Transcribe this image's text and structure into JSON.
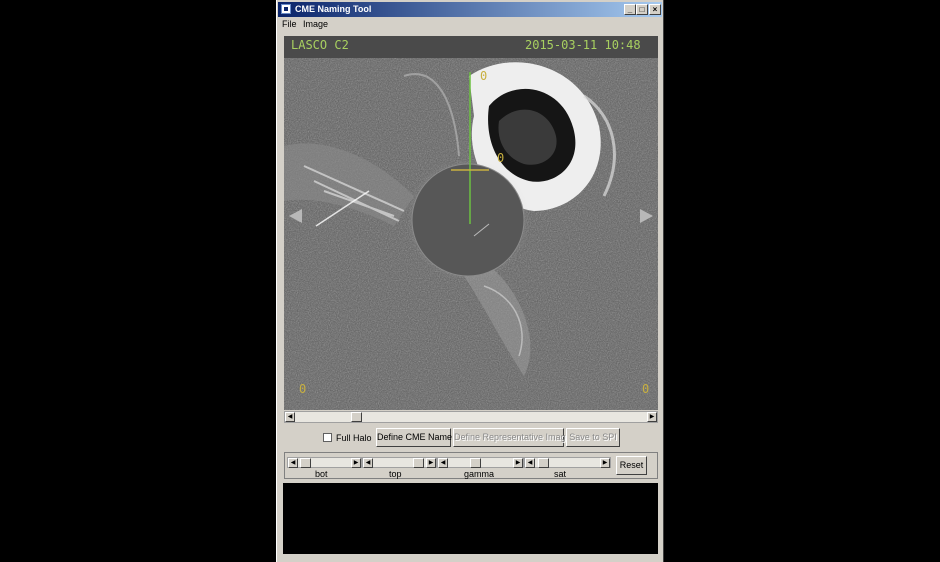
{
  "window": {
    "title": "CME Naming Tool",
    "controls": [
      "_",
      "□",
      "×"
    ]
  },
  "menu": {
    "file": "File",
    "image": "Image"
  },
  "image": {
    "instrument": "LASCO C2",
    "timestamp": "2015-03-11 10:48",
    "markers": [
      "0",
      "0",
      "0",
      "0"
    ],
    "nav_left": "◀",
    "nav_right": "▶"
  },
  "scroll": {
    "left": "◀",
    "right": "▶"
  },
  "controls": {
    "full_halo_label": "Full Halo",
    "full_halo_checked": false,
    "define_cme_name": "Define CME Name",
    "define_representative_image": "Define Representative Image",
    "save_to_spi": "Save to SPI",
    "reset": "Reset"
  },
  "sliders": [
    {
      "label": "bot",
      "value": 0.05
    },
    {
      "label": "top",
      "value": 0.95
    },
    {
      "label": "gamma",
      "value": 0.4
    },
    {
      "label": "sat",
      "value": 0.05
    }
  ],
  "colors": {
    "titlebar": "#0a246a",
    "overlay_text": "#a8d060",
    "crosshair": "#6cc040"
  }
}
